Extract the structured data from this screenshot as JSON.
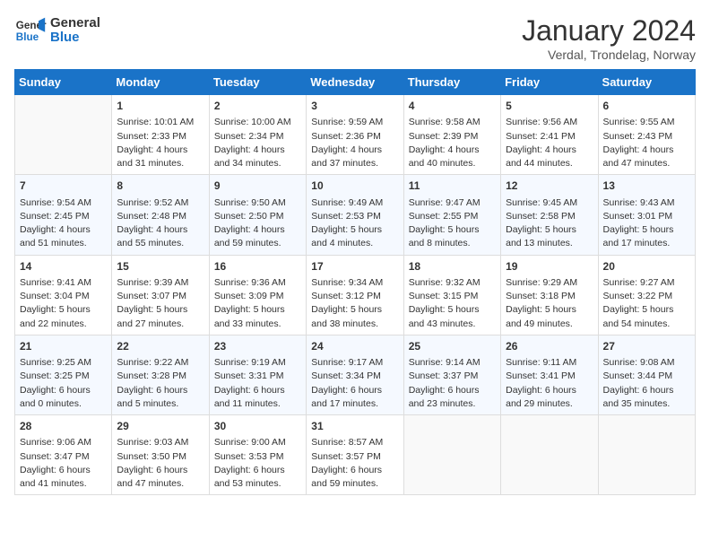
{
  "header": {
    "logo_line1": "General",
    "logo_line2": "Blue",
    "month": "January 2024",
    "location": "Verdal, Trondelag, Norway"
  },
  "days_of_week": [
    "Sunday",
    "Monday",
    "Tuesday",
    "Wednesday",
    "Thursday",
    "Friday",
    "Saturday"
  ],
  "weeks": [
    [
      {
        "day": "",
        "detail": ""
      },
      {
        "day": "1",
        "detail": "Sunrise: 10:01 AM\nSunset: 2:33 PM\nDaylight: 4 hours\nand 31 minutes."
      },
      {
        "day": "2",
        "detail": "Sunrise: 10:00 AM\nSunset: 2:34 PM\nDaylight: 4 hours\nand 34 minutes."
      },
      {
        "day": "3",
        "detail": "Sunrise: 9:59 AM\nSunset: 2:36 PM\nDaylight: 4 hours\nand 37 minutes."
      },
      {
        "day": "4",
        "detail": "Sunrise: 9:58 AM\nSunset: 2:39 PM\nDaylight: 4 hours\nand 40 minutes."
      },
      {
        "day": "5",
        "detail": "Sunrise: 9:56 AM\nSunset: 2:41 PM\nDaylight: 4 hours\nand 44 minutes."
      },
      {
        "day": "6",
        "detail": "Sunrise: 9:55 AM\nSunset: 2:43 PM\nDaylight: 4 hours\nand 47 minutes."
      }
    ],
    [
      {
        "day": "7",
        "detail": "Sunrise: 9:54 AM\nSunset: 2:45 PM\nDaylight: 4 hours\nand 51 minutes."
      },
      {
        "day": "8",
        "detail": "Sunrise: 9:52 AM\nSunset: 2:48 PM\nDaylight: 4 hours\nand 55 minutes."
      },
      {
        "day": "9",
        "detail": "Sunrise: 9:50 AM\nSunset: 2:50 PM\nDaylight: 4 hours\nand 59 minutes."
      },
      {
        "day": "10",
        "detail": "Sunrise: 9:49 AM\nSunset: 2:53 PM\nDaylight: 5 hours\nand 4 minutes."
      },
      {
        "day": "11",
        "detail": "Sunrise: 9:47 AM\nSunset: 2:55 PM\nDaylight: 5 hours\nand 8 minutes."
      },
      {
        "day": "12",
        "detail": "Sunrise: 9:45 AM\nSunset: 2:58 PM\nDaylight: 5 hours\nand 13 minutes."
      },
      {
        "day": "13",
        "detail": "Sunrise: 9:43 AM\nSunset: 3:01 PM\nDaylight: 5 hours\nand 17 minutes."
      }
    ],
    [
      {
        "day": "14",
        "detail": "Sunrise: 9:41 AM\nSunset: 3:04 PM\nDaylight: 5 hours\nand 22 minutes."
      },
      {
        "day": "15",
        "detail": "Sunrise: 9:39 AM\nSunset: 3:07 PM\nDaylight: 5 hours\nand 27 minutes."
      },
      {
        "day": "16",
        "detail": "Sunrise: 9:36 AM\nSunset: 3:09 PM\nDaylight: 5 hours\nand 33 minutes."
      },
      {
        "day": "17",
        "detail": "Sunrise: 9:34 AM\nSunset: 3:12 PM\nDaylight: 5 hours\nand 38 minutes."
      },
      {
        "day": "18",
        "detail": "Sunrise: 9:32 AM\nSunset: 3:15 PM\nDaylight: 5 hours\nand 43 minutes."
      },
      {
        "day": "19",
        "detail": "Sunrise: 9:29 AM\nSunset: 3:18 PM\nDaylight: 5 hours\nand 49 minutes."
      },
      {
        "day": "20",
        "detail": "Sunrise: 9:27 AM\nSunset: 3:22 PM\nDaylight: 5 hours\nand 54 minutes."
      }
    ],
    [
      {
        "day": "21",
        "detail": "Sunrise: 9:25 AM\nSunset: 3:25 PM\nDaylight: 6 hours\nand 0 minutes."
      },
      {
        "day": "22",
        "detail": "Sunrise: 9:22 AM\nSunset: 3:28 PM\nDaylight: 6 hours\nand 5 minutes."
      },
      {
        "day": "23",
        "detail": "Sunrise: 9:19 AM\nSunset: 3:31 PM\nDaylight: 6 hours\nand 11 minutes."
      },
      {
        "day": "24",
        "detail": "Sunrise: 9:17 AM\nSunset: 3:34 PM\nDaylight: 6 hours\nand 17 minutes."
      },
      {
        "day": "25",
        "detail": "Sunrise: 9:14 AM\nSunset: 3:37 PM\nDaylight: 6 hours\nand 23 minutes."
      },
      {
        "day": "26",
        "detail": "Sunrise: 9:11 AM\nSunset: 3:41 PM\nDaylight: 6 hours\nand 29 minutes."
      },
      {
        "day": "27",
        "detail": "Sunrise: 9:08 AM\nSunset: 3:44 PM\nDaylight: 6 hours\nand 35 minutes."
      }
    ],
    [
      {
        "day": "28",
        "detail": "Sunrise: 9:06 AM\nSunset: 3:47 PM\nDaylight: 6 hours\nand 41 minutes."
      },
      {
        "day": "29",
        "detail": "Sunrise: 9:03 AM\nSunset: 3:50 PM\nDaylight: 6 hours\nand 47 minutes."
      },
      {
        "day": "30",
        "detail": "Sunrise: 9:00 AM\nSunset: 3:53 PM\nDaylight: 6 hours\nand 53 minutes."
      },
      {
        "day": "31",
        "detail": "Sunrise: 8:57 AM\nSunset: 3:57 PM\nDaylight: 6 hours\nand 59 minutes."
      },
      {
        "day": "",
        "detail": ""
      },
      {
        "day": "",
        "detail": ""
      },
      {
        "day": "",
        "detail": ""
      }
    ]
  ]
}
